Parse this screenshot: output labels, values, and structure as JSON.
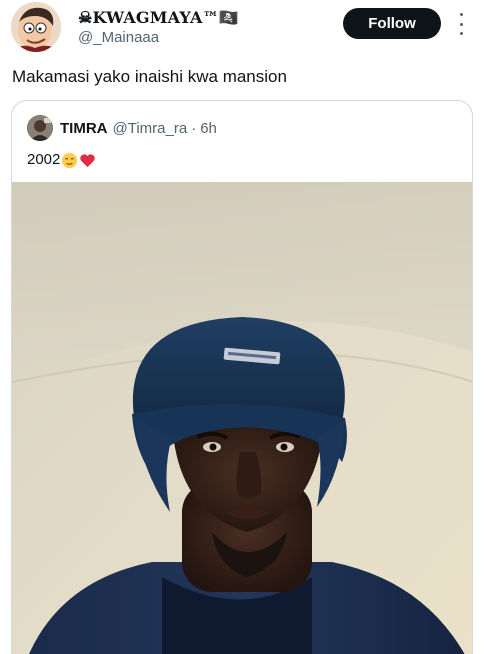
{
  "author": {
    "display_name": "☠KWAGMAYA™🏴‍☠️",
    "handle": "@_Mainaaa",
    "avatar_icon": "cartoon-character-avatar"
  },
  "actions": {
    "follow_label": "Follow",
    "more_icon": "more-vertical-icon"
  },
  "tweet": {
    "text": "Makamasi yako inaishi kwa mansion"
  },
  "quoted": {
    "display_name": "TIMRA",
    "handle": "@Timra_ra",
    "separator": "·",
    "time": "6h",
    "text": "2002",
    "emojis": [
      "relieved-face-emoji",
      "red-heart-emoji"
    ],
    "media": "selfie-photo-man-in-blue-beanie"
  },
  "colors": {
    "text_primary": "#0f1419",
    "text_secondary": "#536471",
    "follow_bg": "#0f1419",
    "border": "#cfd9de"
  }
}
